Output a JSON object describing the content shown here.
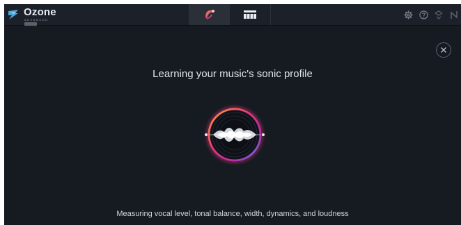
{
  "app": {
    "name": "Ozone",
    "edition": "ADVANCED"
  },
  "tabs": [
    {
      "id": "assistant",
      "active": true,
      "icon": "assistant-icon"
    },
    {
      "id": "modules",
      "active": false,
      "icon": "modules-icon"
    }
  ],
  "header_icons": [
    "settings-icon",
    "help-icon",
    "undo-icon",
    "bypass-icon"
  ],
  "assistant": {
    "headline": "Learning your music's sonic profile",
    "status": "Measuring vocal level, tonal balance, width, dynamics, and loudness"
  },
  "colors": {
    "background": "#161a21",
    "topbar": "#1c2028",
    "accent_orange": "#f07a2a",
    "accent_pink": "#d63a8e",
    "accent_blue": "#3aa0ff"
  }
}
